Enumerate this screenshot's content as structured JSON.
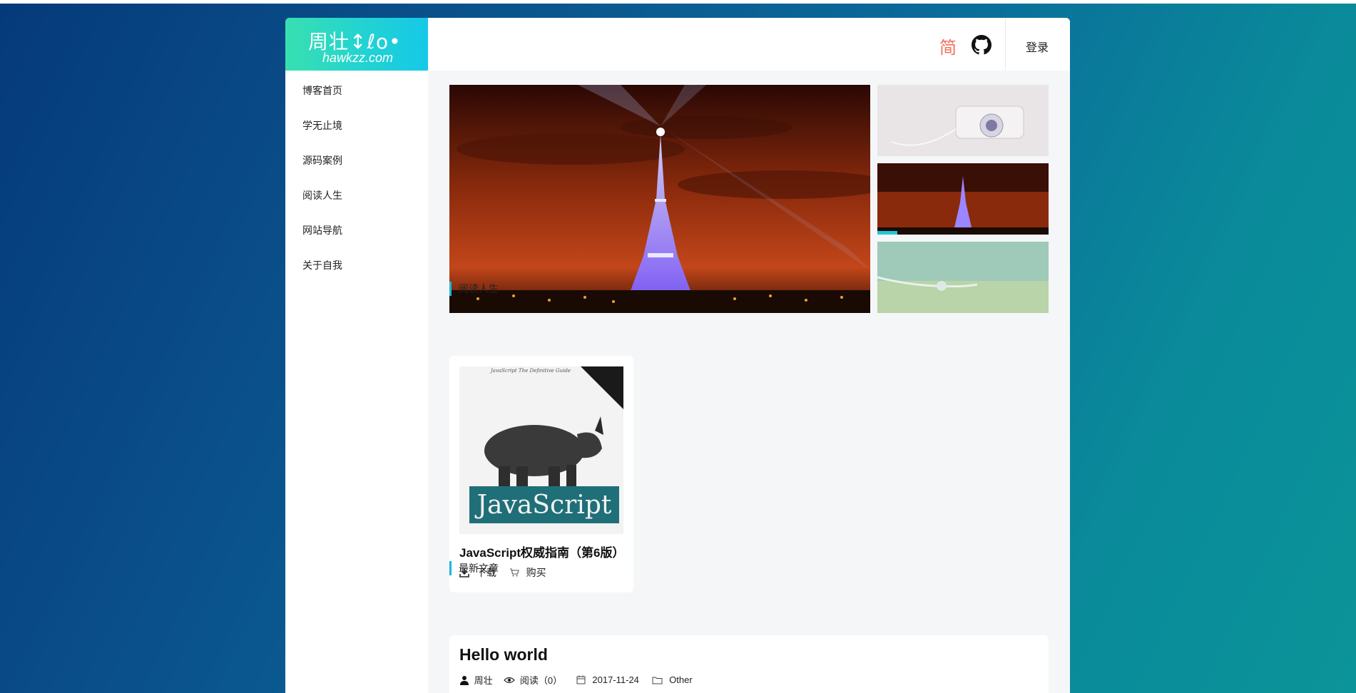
{
  "brand": {
    "logo_cn": "周壮",
    "logo_domain": "hawkzz.com"
  },
  "header": {
    "lang_toggle": "简",
    "github_icon": "github-icon",
    "login_label": "登录"
  },
  "sidebar": {
    "items": [
      {
        "label": "博客首页"
      },
      {
        "label": "学无止境"
      },
      {
        "label": "源码案例"
      },
      {
        "label": "阅读人生"
      },
      {
        "label": "网站导航"
      },
      {
        "label": "关于自我"
      }
    ]
  },
  "carousel": {
    "main_image": "eiffel-tower-night",
    "thumbnails": [
      "camera",
      "eiffel-tower-night",
      "earphones-glitter"
    ],
    "active_index": 1
  },
  "reading": {
    "section_title": "阅读人生",
    "books": [
      {
        "title": "JavaScript权威指南（第6版）",
        "cover_header": "JavaScript The Definitive Guide",
        "cover_title": "JavaScript",
        "download_label": "下载",
        "buy_label": "购买"
      }
    ]
  },
  "latest": {
    "section_title": "最新文章",
    "posts": [
      {
        "title": "Hello world",
        "author": "周壮",
        "views": "阅读（0）",
        "date": "2017-11-24",
        "category": "Other"
      }
    ]
  },
  "colors": {
    "accent": "#1ab7e0",
    "lang_toggle": "#f0705a",
    "logo_gradient_start": "#38e0b0",
    "logo_gradient_end": "#16c8e8"
  }
}
